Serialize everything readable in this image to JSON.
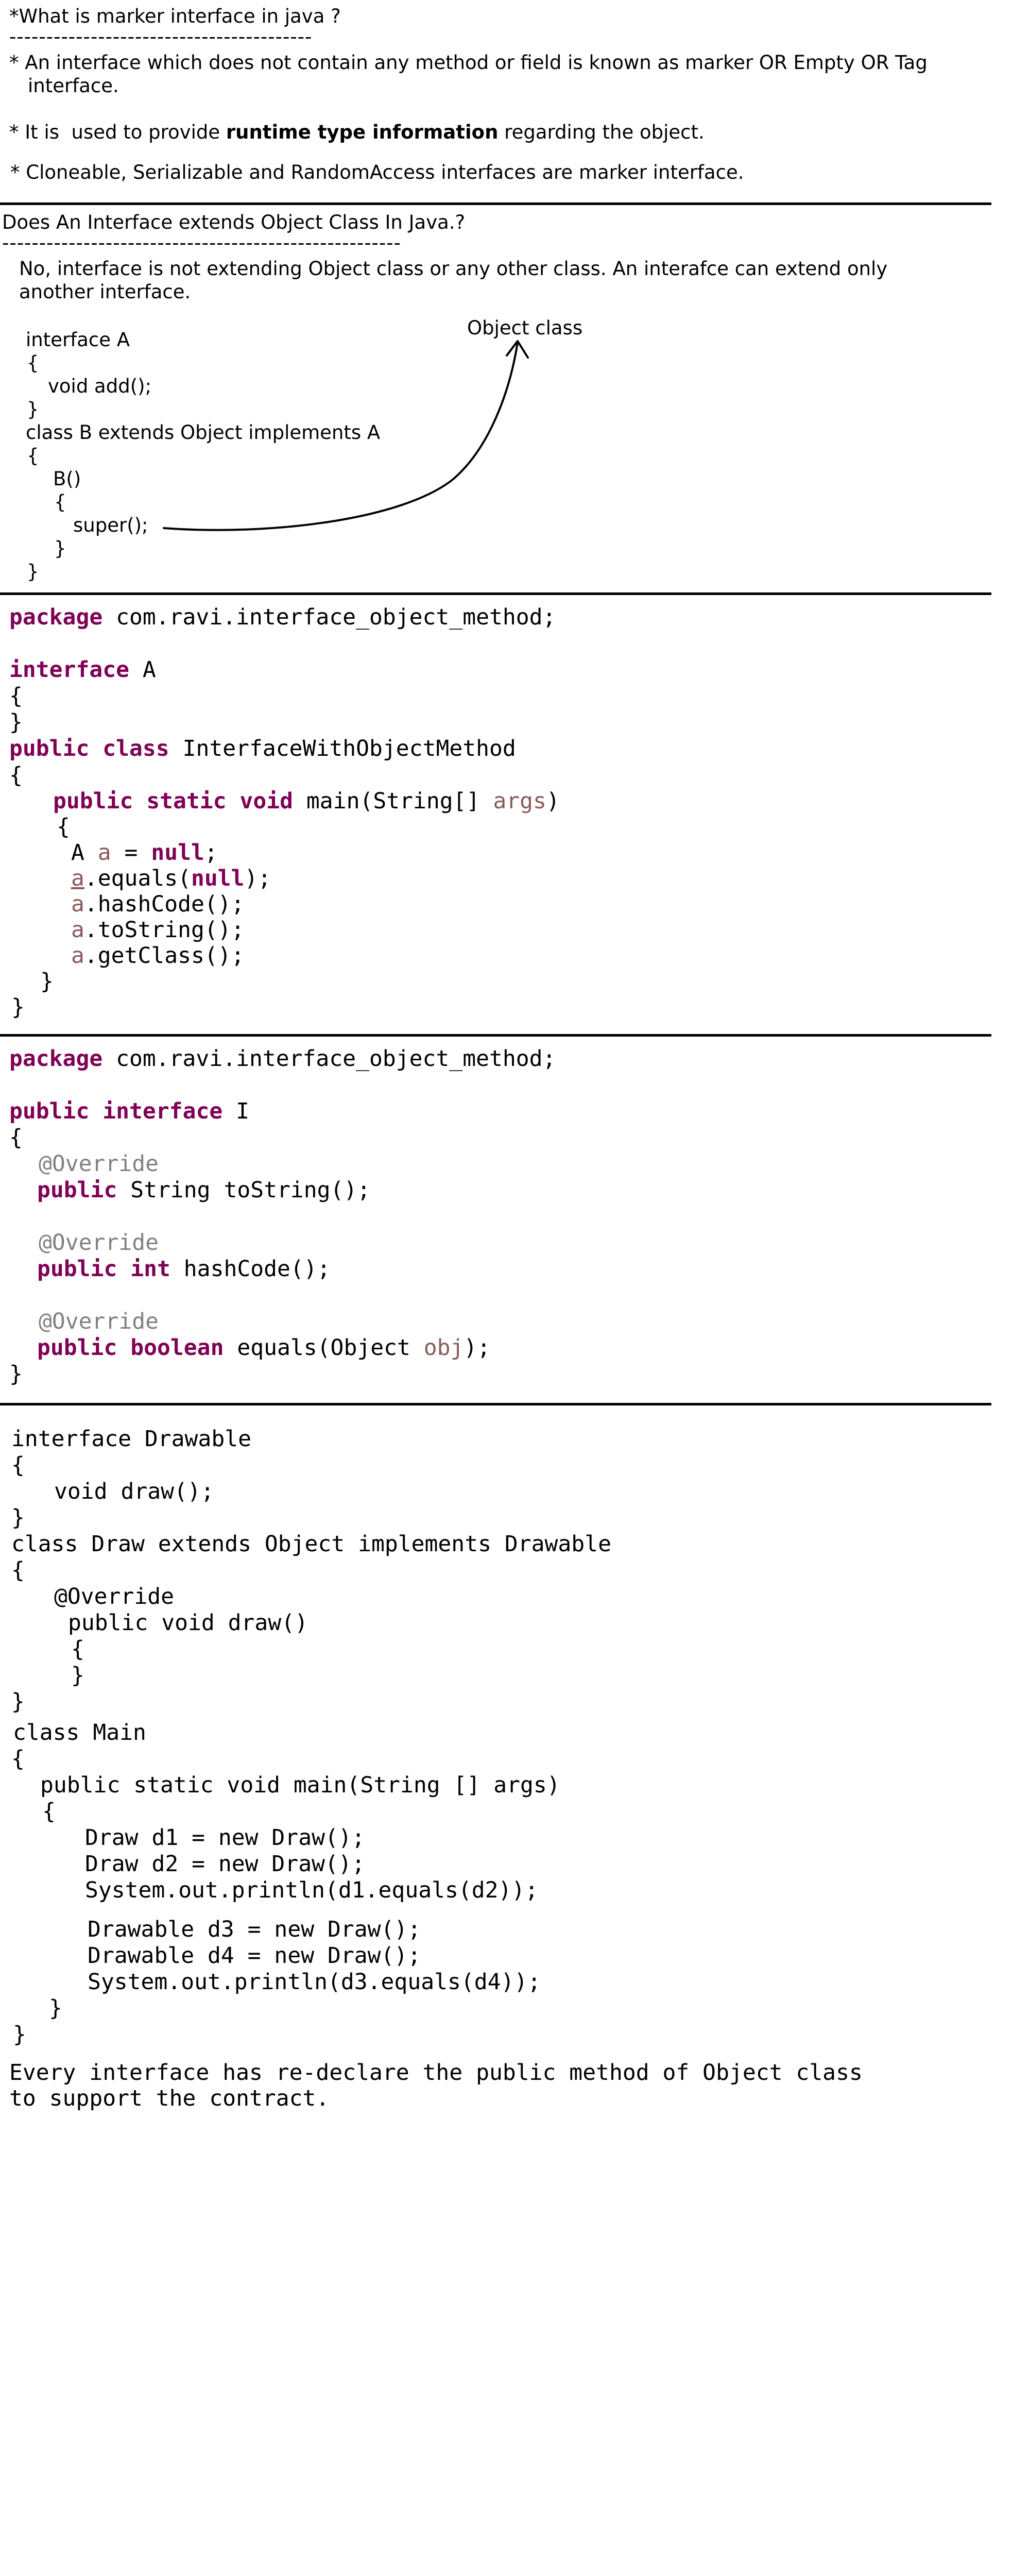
{
  "marker": {
    "heading": "*What is marker interface in java ?",
    "dashes": "-----------------------------------------",
    "bullet1_a": "* An interface which does not contain any method or field is known as marker OR Empty OR Tag",
    "bullet1_b": "interface.",
    "bullet2_pre": "* It is  used to provide ",
    "bullet2_bold": "runtime type information",
    "bullet2_post": " regarding the object.",
    "bullet3": "* Cloneable, Serializable and RandomAccess interfaces are marker interface."
  },
  "extends_q": {
    "heading": "Does An Interface extends Object Class In Java.?",
    "dashes": "------------------------------------------------------",
    "answer_a": "No, interface is not extending Object class or any other class. An interafce can extend only",
    "answer_b": "another interface.",
    "object_class_label": "Object class",
    "code": [
      "interface A",
      "{",
      "void add();",
      "}",
      "class B extends Object implements A",
      "{",
      "B()",
      "{",
      "super();",
      "}",
      "}"
    ]
  },
  "code1": {
    "package_kw": "package",
    "package_name": " com.ravi.interface_object_method;",
    "interface_kw": "interface",
    "interface_name": " A",
    "brace_open": "{",
    "brace_close": "}",
    "public_kw": "public",
    "class_kw": "class",
    "class_name": " InterfaceWithObjectMethod",
    "static_kw": "static",
    "void_kw": "void",
    "main_sig": " main(String[] ",
    "args": "args",
    "close_paren": ")",
    "a_decl_pre": "A ",
    "a_var": "a",
    "a_decl_mid": " = ",
    "null_kw": "null",
    "semi": ";",
    "equals_call": ".equals(",
    "equals_end": ");",
    "hash_call": ".hashCode();",
    "tostring_call": ".toString();",
    "getclass_call": ".getClass();"
  },
  "code2": {
    "package_kw": "package",
    "package_name": " com.ravi.interface_object_method;",
    "public_kw": "public",
    "interface_kw": "interface",
    "interface_name": " I",
    "brace_open": "{",
    "brace_close": "}",
    "override": "@Override",
    "string_sig": " String toString();",
    "int_kw": "int",
    "hash_sig": " hashCode();",
    "boolean_kw": "boolean",
    "equals_sig": " equals(Object ",
    "obj": "obj",
    "equals_end": ");"
  },
  "code3": {
    "lines": [
      "interface Drawable",
      "{",
      "void draw();",
      "}",
      "class Draw extends Object implements Drawable",
      "{",
      "@Override",
      "public void draw()",
      "{",
      "}",
      "}",
      "class Main",
      "{",
      "public static void main(String [] args)",
      "{",
      "Draw d1 = new Draw();",
      "Draw d2 = new Draw();",
      "System.out.println(d1.equals(d2));",
      "Drawable d3 = new Draw();",
      "Drawable d4 = new Draw();",
      "System.out.println(d3.equals(d4));",
      "}",
      "}"
    ],
    "footer_a": "Every interface has re-declare the public method of Object class",
    "footer_b": "to support the contract."
  }
}
